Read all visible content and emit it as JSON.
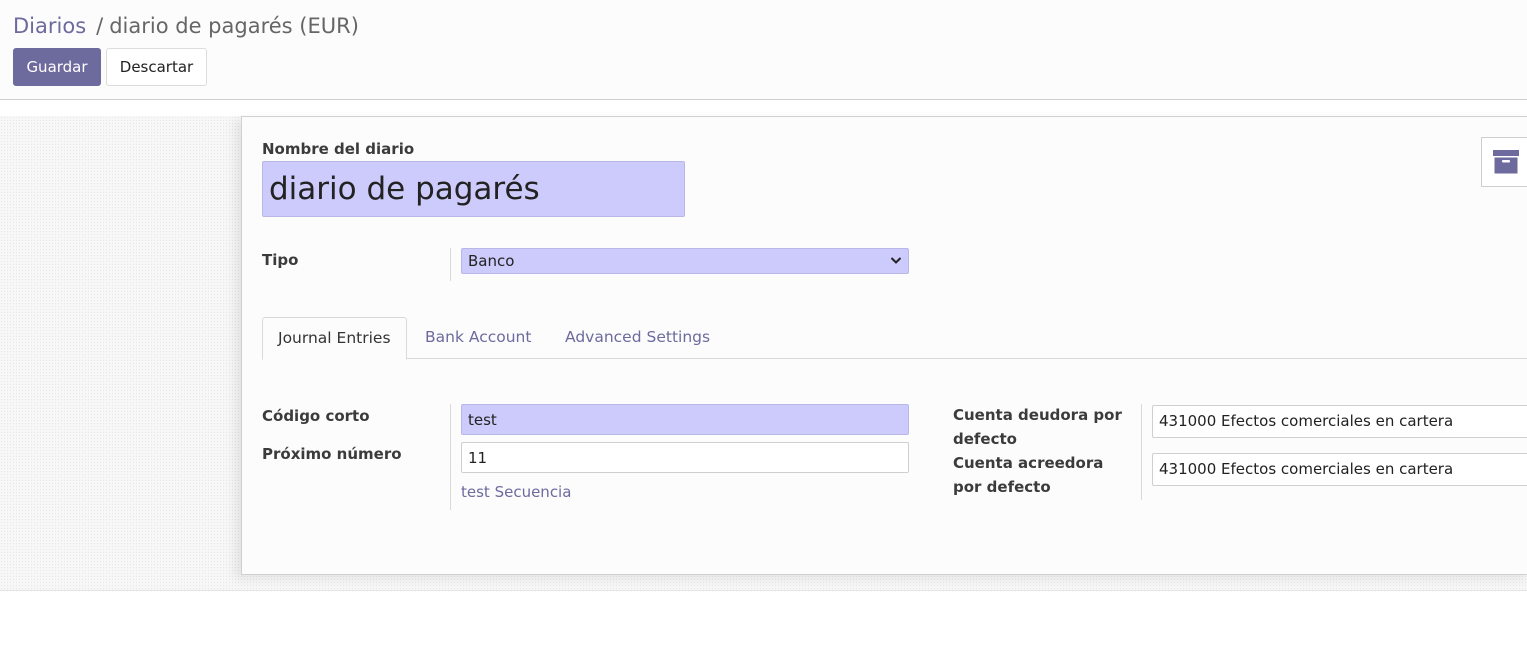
{
  "breadcrumb": {
    "parent": "Diarios",
    "separator": "/",
    "current": "diario de pagarés (EUR)"
  },
  "toolbar": {
    "save_label": "Guardar",
    "discard_label": "Descartar"
  },
  "form": {
    "name_label": "Nombre del diario",
    "name_value": "diario de pagarés",
    "archive_icon": "archive-icon",
    "tipo_label": "Tipo",
    "tipo_value": "Banco",
    "tabs": [
      {
        "label": "Journal Entries",
        "active": true
      },
      {
        "label": "Bank Account",
        "active": false
      },
      {
        "label": "Advanced Settings",
        "active": false
      }
    ],
    "codigo_label": "Código corto",
    "codigo_value": "test",
    "proximo_label": "Próximo número",
    "proximo_value": "11",
    "secuencia_link": "test Secuencia",
    "deudora_label": "Cuenta deudora por defecto",
    "deudora_value": "431000 Efectos comerciales en cartera",
    "acreedora_label": "Cuenta acreedora por defecto",
    "acreedora_value": "431000 Efectos comerciales en cartera"
  },
  "colors": {
    "brand": "#6d6a9e",
    "highlight_field": "#cdcbfb"
  }
}
